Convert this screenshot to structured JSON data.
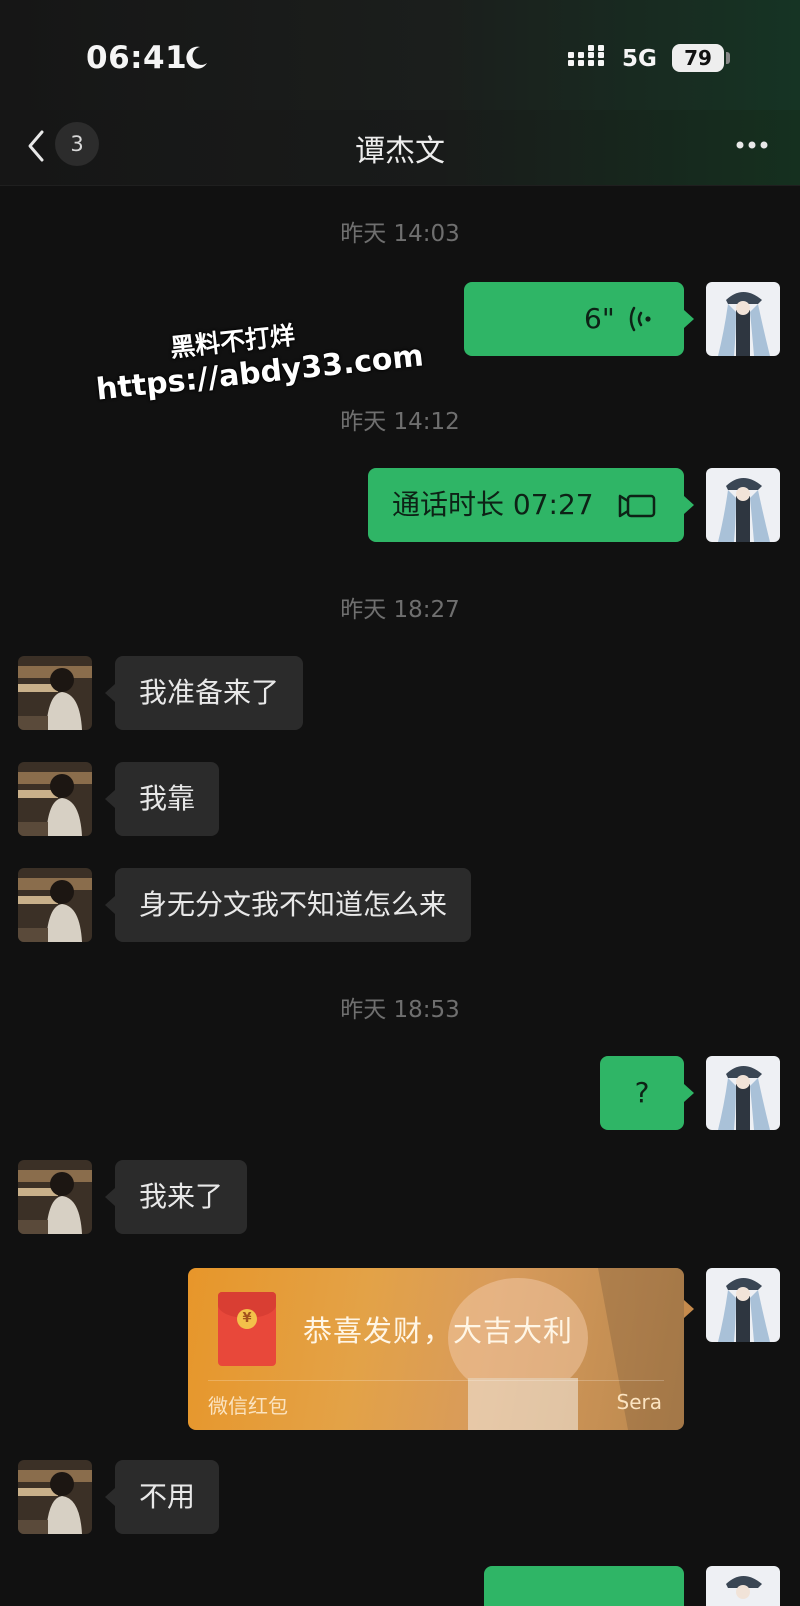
{
  "status_bar": {
    "time": "06:41",
    "network": "5G",
    "battery": "79"
  },
  "nav": {
    "unread_count": "3",
    "title": "谭杰文"
  },
  "timestamps": [
    "昨天 14:03",
    "昨天 14:12",
    "昨天 18:27",
    "昨天 18:53"
  ],
  "messages": {
    "voice_duration": "6\"",
    "call_duration": "通话时长 07:27",
    "in_1": "我准备来了",
    "in_2": "我靠",
    "in_3": "身无分文我不知道怎么来",
    "out_question": "?",
    "in_4": "我来了",
    "in_5": "不用"
  },
  "red_packet": {
    "greeting": "恭喜发财，大吉大利",
    "label": "微信红包",
    "sender": "Sera"
  },
  "watermark": {
    "line1": "黑料不打烊",
    "line2": "https://abdy33.com"
  },
  "colors": {
    "outgoing_bubble": "#2fb566",
    "incoming_bubble": "#2b2b2b",
    "background": "#111111",
    "red_packet": "#e7962a"
  }
}
